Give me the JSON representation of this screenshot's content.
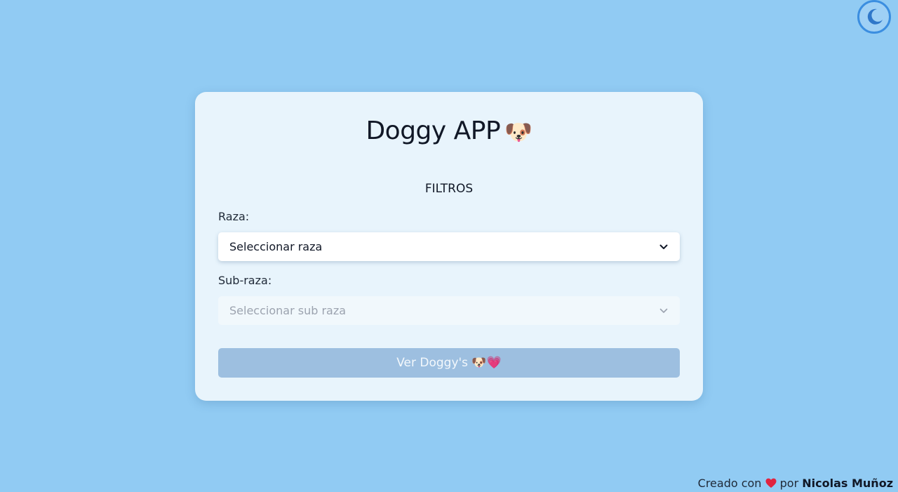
{
  "theme_toggle": {
    "icon": "moon-icon"
  },
  "app": {
    "title": "Doggy APP",
    "title_emoji": "🐶"
  },
  "filters": {
    "heading": "FILTROS",
    "breed": {
      "label": "Raza:",
      "placeholder": "Seleccionar raza"
    },
    "sub_breed": {
      "label": "Sub-raza:",
      "placeholder": "Seleccionar sub raza"
    }
  },
  "submit": {
    "label": "Ver Doggy's 🐶💗"
  },
  "footer": {
    "prefix": "Creado con",
    "heart_icon": "heart-icon",
    "by": "por",
    "author": "Nicolas Muñoz"
  },
  "colors": {
    "background": "#91cbf3",
    "card": "#e8f4fc",
    "button_disabled": "#9dbfe0",
    "toggle_accent": "#3b8ee0"
  }
}
